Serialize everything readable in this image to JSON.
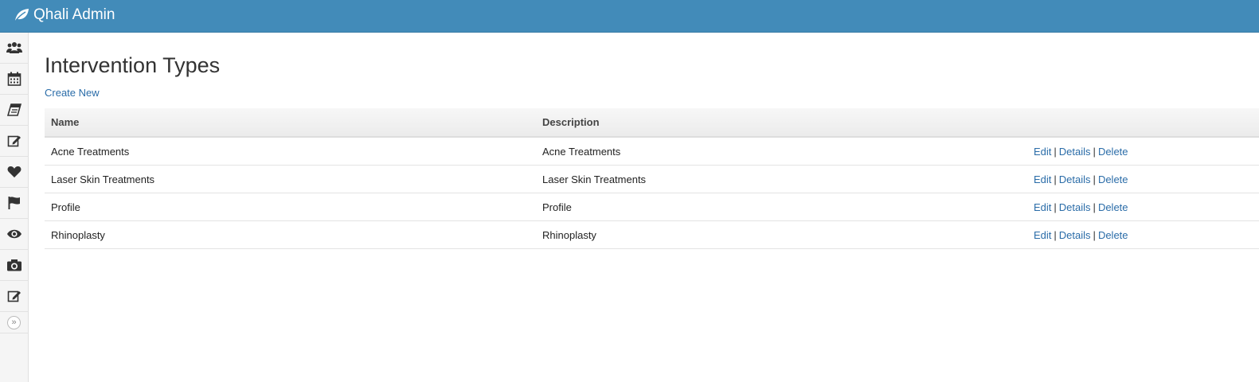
{
  "app": {
    "brand": "Qhali Admin",
    "brand_icon": "leaf-icon"
  },
  "sidebar": {
    "items": [
      {
        "icon": "users-icon"
      },
      {
        "icon": "calendar-icon"
      },
      {
        "icon": "book-icon"
      },
      {
        "icon": "edit-icon"
      },
      {
        "icon": "heart-icon"
      },
      {
        "icon": "flag-icon"
      },
      {
        "icon": "eye-icon"
      },
      {
        "icon": "camera-icon"
      },
      {
        "icon": "edit-icon"
      }
    ],
    "collapse_label": "»"
  },
  "page": {
    "title": "Intervention Types",
    "create_link": "Create New"
  },
  "table": {
    "headers": {
      "name": "Name",
      "description": "Description"
    },
    "rows": [
      {
        "name": "Acne Treatments",
        "description": "Acne Treatments"
      },
      {
        "name": "Laser Skin Treatments",
        "description": "Laser Skin Treatments"
      },
      {
        "name": "Profile",
        "description": "Profile"
      },
      {
        "name": "Rhinoplasty",
        "description": "Rhinoplasty"
      }
    ],
    "actions": {
      "edit": "Edit",
      "details": "Details",
      "delete": "Delete",
      "separator": "|"
    }
  },
  "colors": {
    "navbar": "#428bb9",
    "link": "#2a6ca8"
  }
}
